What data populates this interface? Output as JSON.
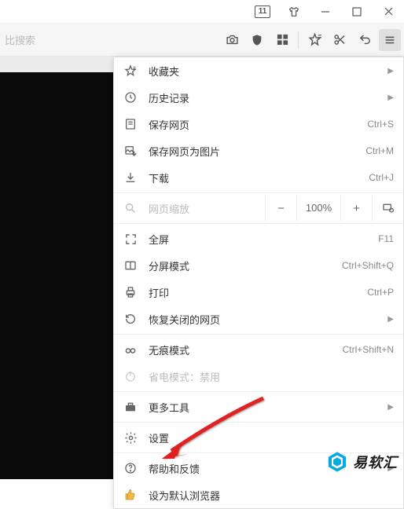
{
  "window": {
    "tab_count": "11"
  },
  "toolbar": {
    "search_placeholder": "比搜索"
  },
  "menu": {
    "favorites": "收藏夹",
    "history": "历史记录",
    "save_page": "保存网页",
    "save_page_sc": "Ctrl+S",
    "save_image": "保存网页为图片",
    "save_image_sc": "Ctrl+M",
    "downloads": "下载",
    "downloads_sc": "Ctrl+J",
    "zoom_label": "网页缩放",
    "zoom_value": "100%",
    "fullscreen": "全屏",
    "fullscreen_sc": "F11",
    "split": "分屏模式",
    "split_sc": "Ctrl+Shift+Q",
    "print": "打印",
    "print_sc": "Ctrl+P",
    "restore": "恢复关闭的网页",
    "incognito": "无痕模式",
    "incognito_sc": "Ctrl+Shift+N",
    "power_save": "省电模式：禁用",
    "more_tools": "更多工具",
    "settings": "设置",
    "help": "帮助和反馈",
    "default_browser": "设为默认浏览器"
  },
  "watermark": {
    "text": "易软汇"
  }
}
